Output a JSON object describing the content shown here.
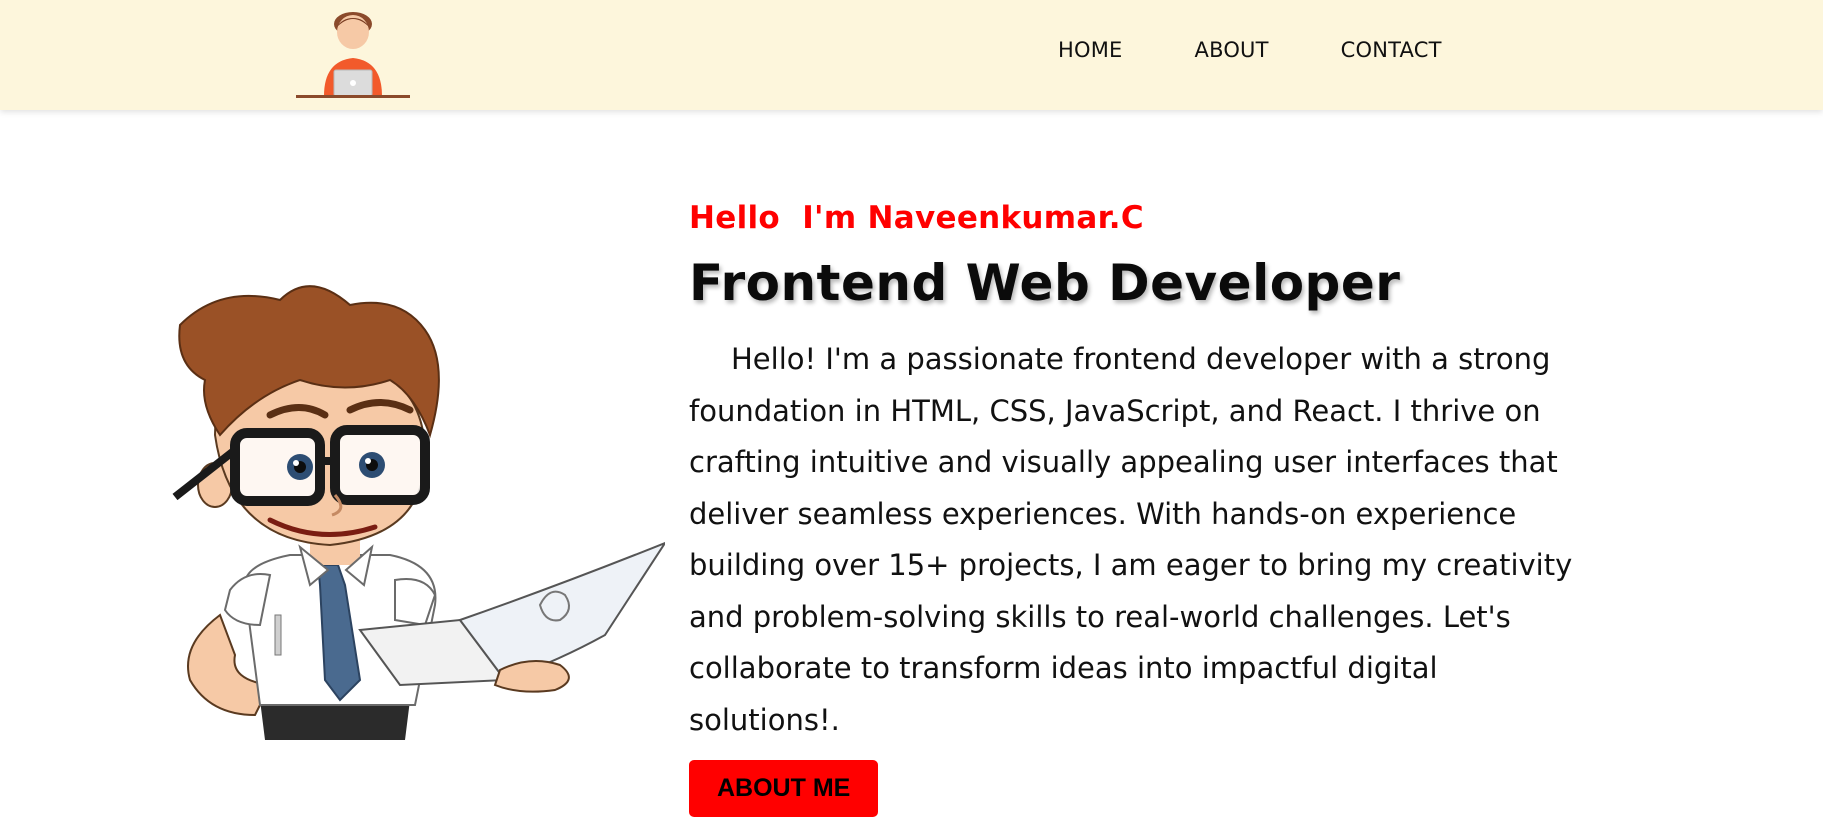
{
  "nav": {
    "links": [
      {
        "label": "HOME"
      },
      {
        "label": "ABOUT"
      },
      {
        "label": "CONTACT"
      }
    ]
  },
  "hero": {
    "greeting": "Hello  I'm Naveenkumar.C",
    "title": "Frontend Web Developer",
    "bio": "Hello! I'm a passionate frontend developer with a strong foundation in HTML, CSS, JavaScript, and React. I thrive on crafting intuitive and visually appealing user interfaces that deliver seamless experiences. With hands-on experience building over 15+ projects, I am eager to bring my creativity and problem-solving skills to real-world challenges. Let's collaborate to transform ideas into impactful digital solutions!.",
    "button_label": "ABOUT ME"
  },
  "colors": {
    "navbar_bg": "#fdf6dc",
    "accent": "#ff0000",
    "text": "#111111"
  },
  "icons": {
    "logo": "developer-at-laptop-icon",
    "illustration": "cartoon-developer-with-laptop"
  }
}
